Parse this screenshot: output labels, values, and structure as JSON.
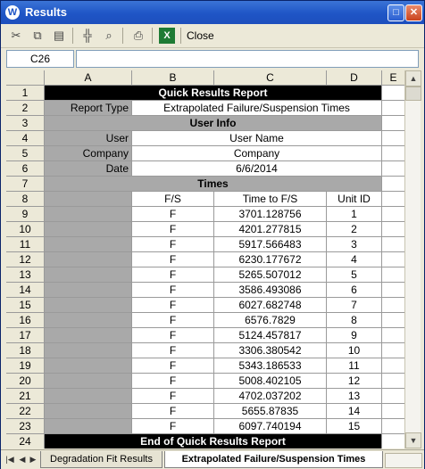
{
  "window": {
    "title": "Results",
    "icon_letter": "W"
  },
  "titlebar_buttons": {
    "minimize": "_",
    "maximize": "□",
    "close": "✕"
  },
  "toolbar": {
    "close_label": "Close"
  },
  "formula_bar": {
    "cell_ref": "C26",
    "value": ""
  },
  "columns": [
    "A",
    "B",
    "C",
    "D",
    "E"
  ],
  "rows": {
    "r1": {
      "num": "1",
      "text": "Quick Results Report"
    },
    "r2": {
      "num": "2",
      "label": "Report Type",
      "value": "Extrapolated Failure/Suspension Times"
    },
    "r3": {
      "num": "3",
      "text": "User Info"
    },
    "r4": {
      "num": "4",
      "label": "User",
      "value": "User Name"
    },
    "r5": {
      "num": "5",
      "label": "Company",
      "value": "Company"
    },
    "r6": {
      "num": "6",
      "label": "Date",
      "value": "6/6/2014"
    },
    "r7": {
      "num": "7",
      "text": "Times"
    },
    "r8": {
      "num": "8",
      "fs": "F/S",
      "time": "Time to F/S",
      "unit": "Unit ID"
    },
    "r24": {
      "num": "24",
      "text": "End of Quick Results Report"
    }
  },
  "times": [
    {
      "num": "9",
      "fs": "F",
      "time": "3701.128756",
      "unit": "1"
    },
    {
      "num": "10",
      "fs": "F",
      "time": "4201.277815",
      "unit": "2"
    },
    {
      "num": "11",
      "fs": "F",
      "time": "5917.566483",
      "unit": "3"
    },
    {
      "num": "12",
      "fs": "F",
      "time": "6230.177672",
      "unit": "4"
    },
    {
      "num": "13",
      "fs": "F",
      "time": "5265.507012",
      "unit": "5"
    },
    {
      "num": "14",
      "fs": "F",
      "time": "3586.493086",
      "unit": "6"
    },
    {
      "num": "15",
      "fs": "F",
      "time": "6027.682748",
      "unit": "7"
    },
    {
      "num": "16",
      "fs": "F",
      "time": "6576.7829",
      "unit": "8"
    },
    {
      "num": "17",
      "fs": "F",
      "time": "5124.457817",
      "unit": "9"
    },
    {
      "num": "18",
      "fs": "F",
      "time": "3306.380542",
      "unit": "10"
    },
    {
      "num": "19",
      "fs": "F",
      "time": "5343.186533",
      "unit": "11"
    },
    {
      "num": "20",
      "fs": "F",
      "time": "5008.402105",
      "unit": "12"
    },
    {
      "num": "21",
      "fs": "F",
      "time": "4702.037202",
      "unit": "13"
    },
    {
      "num": "22",
      "fs": "F",
      "time": "5655.87835",
      "unit": "14"
    },
    {
      "num": "23",
      "fs": "F",
      "time": "6097.740194",
      "unit": "15"
    }
  ],
  "sheet_tabs": [
    "Degradation Fit Results",
    "Extrapolated Failure/Suspension Times"
  ],
  "active_tab": "Extrapolated Failure/Suspension Times"
}
